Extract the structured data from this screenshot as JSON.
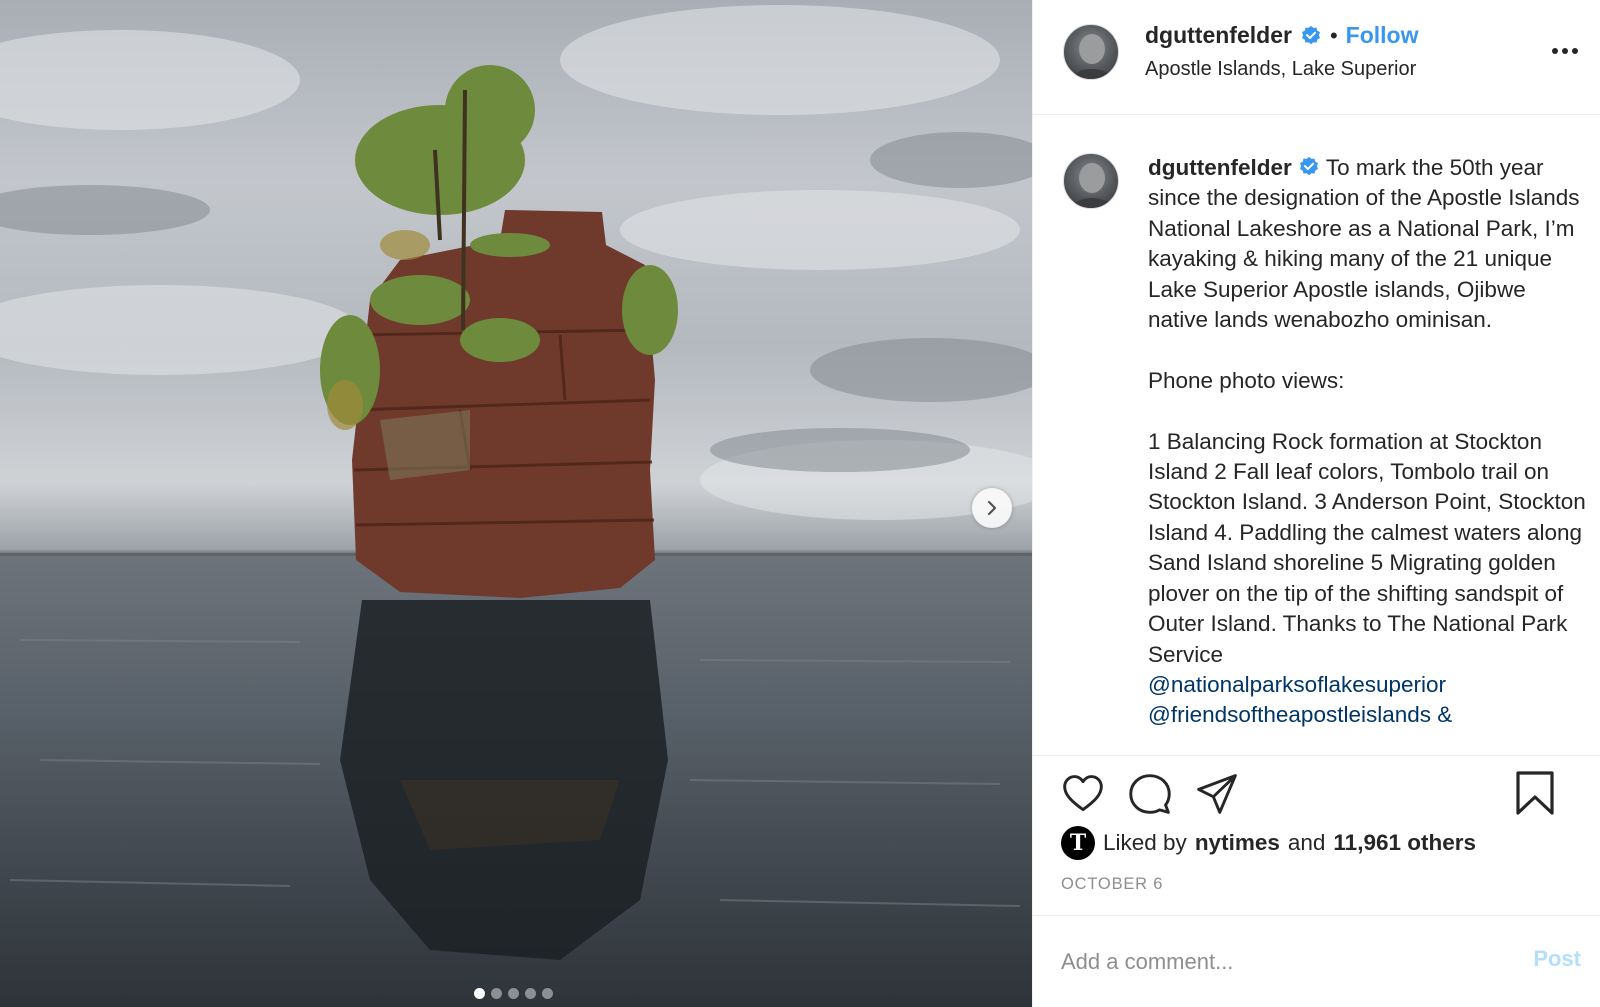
{
  "post": {
    "username": "dguttenfelder",
    "verified": true,
    "separator": "•",
    "follow_label": "Follow",
    "location": "Apostle Islands, Lake Superior",
    "more_icon": "more-horizontal-icon",
    "photo": {
      "subject": "balancing-rock-photo",
      "carousel_total": 5,
      "carousel_active": 1,
      "next_icon": "chevron-right-icon"
    },
    "caption": {
      "username": "dguttenfelder",
      "text_main": "To mark the 50th year since the designation of the Apostle Islands National Lakeshore as a National Park, I’m kayaking & hiking many of the 21 unique Lake Superior Apostle islands, Ojibwe native lands wenabozho ominisan.",
      "text_views_heading": "Phone photo views:",
      "text_views_body": "1 Balancing Rock formation at Stockton Island 2 Fall leaf colors, Tombolo trail on Stockton Island. 3 Anderson Point, Stockton Island 4. Paddling the calmest waters along Sand Island shoreline 5 Migrating golden plover on the tip of the shifting sandspit of Outer Island. Thanks to The National Park Service",
      "mention_1": "@nationalparksoflakesuperior",
      "mention_2": "@friendsoftheapostleislands &"
    },
    "likes": {
      "prefix": "Liked by",
      "liker": "nytimes",
      "liker_avatar_letter": "T",
      "joiner": "and",
      "others": "11,961 others"
    },
    "date": "OCTOBER 6",
    "comment": {
      "placeholder": "Add a comment...",
      "post_label": "Post"
    },
    "colors": {
      "link_blue": "#3897f0",
      "mention_navy": "#003569",
      "post_disabled": "#b2dffc",
      "muted": "#8e8e8e"
    }
  }
}
